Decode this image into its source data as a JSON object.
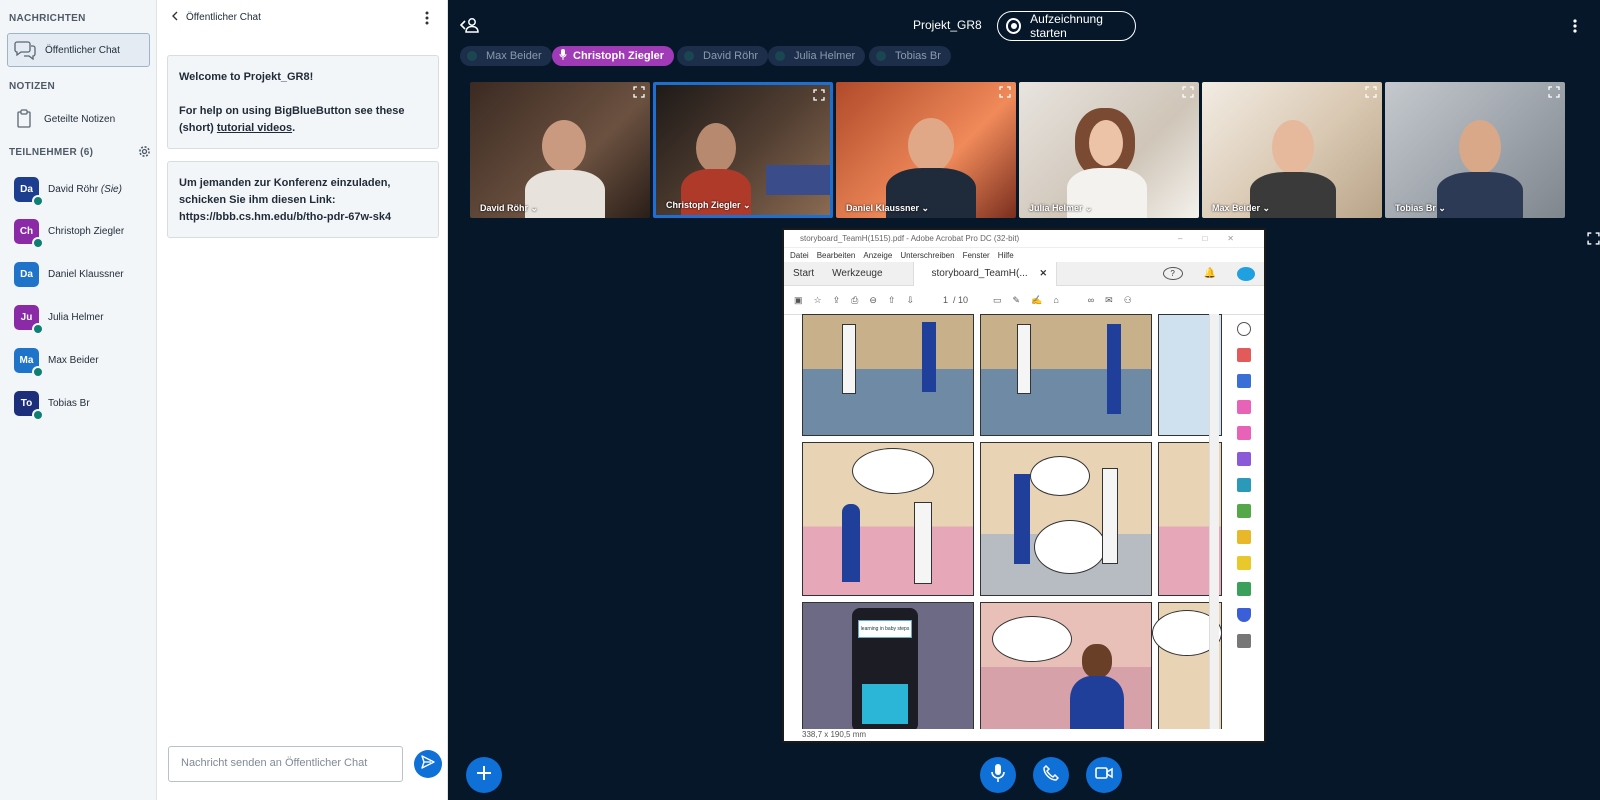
{
  "nav": {
    "messages_heading": "NACHRICHTEN",
    "public_chat_label": "Öffentlicher Chat",
    "notes_heading": "NOTIZEN",
    "shared_notes_label": "Geteilte Notizen",
    "participants_heading": "TEILNEHMER (6)",
    "users": [
      {
        "initials": "Da",
        "name": "David Röhr",
        "suffix": "(Sie)",
        "color": "#1d3d8f"
      },
      {
        "initials": "Ch",
        "name": "Christoph Ziegler",
        "suffix": "",
        "color": "#8a2aa6"
      },
      {
        "initials": "Da",
        "name": "Daniel Klaussner",
        "suffix": "",
        "color": "#1f74c9"
      },
      {
        "initials": "Ju",
        "name": "Julia Helmer",
        "suffix": "",
        "color": "#8a2aa6"
      },
      {
        "initials": "Ma",
        "name": "Max Beider",
        "suffix": "",
        "color": "#1f74c9"
      },
      {
        "initials": "To",
        "name": "Tobias Br",
        "suffix": "",
        "color": "#1d2f7a"
      }
    ]
  },
  "chat": {
    "header": "Öffentlicher Chat",
    "welcome_line1": "Welcome to Projekt_GR8!",
    "welcome_line2": "For help on using BigBlueButton see these (short)",
    "welcome_link": "tutorial videos",
    "welcome_end": ".",
    "invite_text": "Um jemanden zur Konferenz einzuladen, schicken Sie ihm diesen Link:",
    "invite_link": "https://bbb.cs.hm.edu/b/tho-pdr-67w-sk4",
    "input_placeholder": "Nachricht senden an Öffentlicher Chat"
  },
  "main": {
    "meeting_title": "Projekt_GR8",
    "record_label": "Aufzeichnung starten",
    "talkers": [
      "Max Beider",
      "Christoph Ziegler",
      "David Röhr",
      "Julia Helmer",
      "Tobias Br"
    ],
    "active_talker": "Christoph Ziegler",
    "videos": [
      "David Röhr",
      "Christoph Ziegler",
      "Daniel Klaussner",
      "Julia Helmer",
      "Max Beider",
      "Tobias Br"
    ]
  },
  "pdf": {
    "window_title": "storyboard_TeamH(1515).pdf - Adobe Acrobat Pro DC (32-bit)",
    "menu": [
      "Datei",
      "Bearbeiten",
      "Anzeige",
      "Unterschreiben",
      "Fenster",
      "Hilfe"
    ],
    "tabs": [
      "Start",
      "Werkzeuge",
      "storyboard_TeamH(..."
    ],
    "page_current": "1",
    "page_total": "/ 10",
    "page_size": "338,7 x 190,5 mm",
    "phone_text": "learning in baby steps"
  },
  "colors": {
    "accent": "#0f70d7",
    "talking": "#a03ab6",
    "background": "#06172a"
  }
}
